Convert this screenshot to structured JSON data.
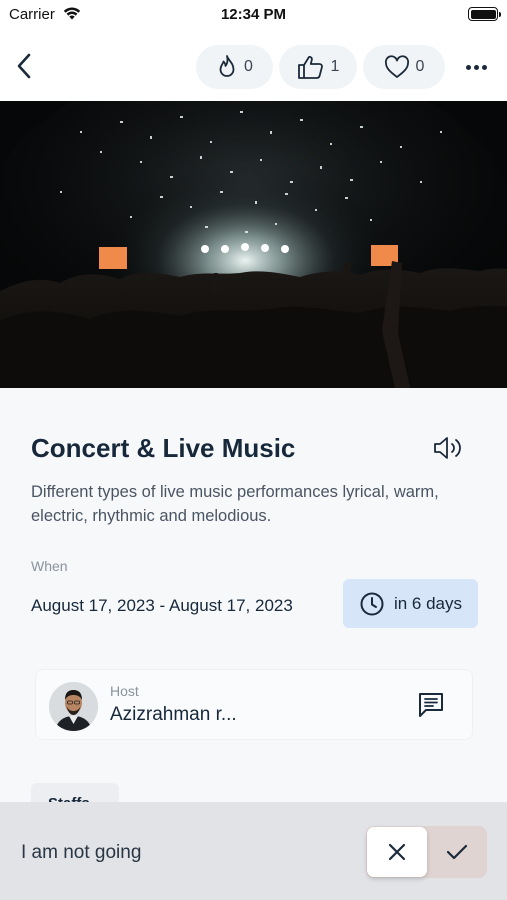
{
  "status_bar": {
    "carrier": "Carrier",
    "time": "12:34 PM"
  },
  "nav": {
    "back_icon": "chevron-left-icon",
    "reactions": [
      {
        "icon": "fire-icon",
        "count": "0"
      },
      {
        "icon": "thumbs-up-icon",
        "count": "1"
      },
      {
        "icon": "heart-icon",
        "count": "0"
      }
    ],
    "more_icon": "more-horizontal-icon"
  },
  "hero": {
    "image": "concert-crowd-confetti-photo"
  },
  "event": {
    "title": "Concert & Live Music",
    "description": "Different types of live music performances lyrical, warm, electric, rhythmic and melodious.",
    "when_label": "When",
    "date_range": "August 17, 2023 - August 17, 2023",
    "countdown": "in 6 days"
  },
  "host": {
    "label": "Host",
    "name": "Azizrahman r..."
  },
  "staff": {
    "label": "Staffs"
  },
  "rsvp": {
    "status_text": "I am not going",
    "selected": "not_going"
  },
  "colors": {
    "primary_text": "#16283a",
    "badge_bg": "#d6e5f8",
    "bottom_bar": "#e1e3e7",
    "accept_bg": "#e0d4d2"
  }
}
